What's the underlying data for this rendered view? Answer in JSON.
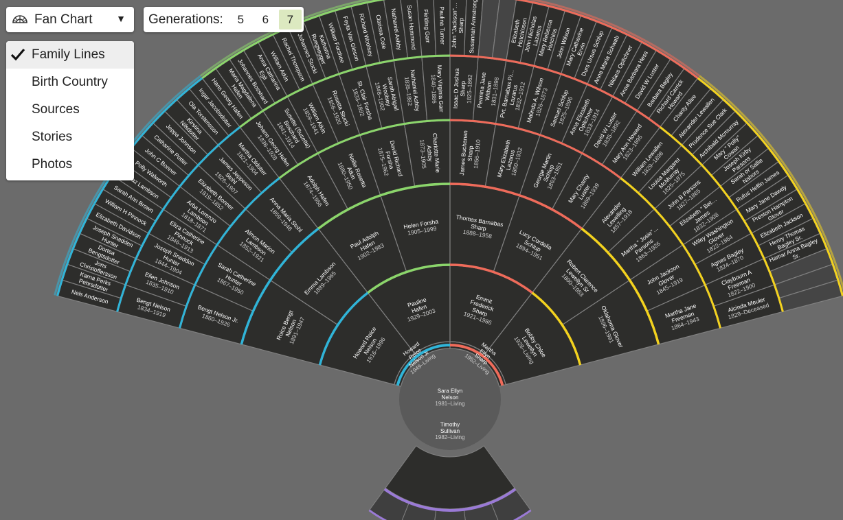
{
  "toolbar": {
    "view_label": "Fan Chart",
    "caret": "▼",
    "fan_icon": "fan-chart-icon",
    "generations_label": "Generations:",
    "generation_options": [
      "5",
      "6",
      "7"
    ],
    "selected_generation": "7"
  },
  "menu": {
    "items": [
      "Family Lines",
      "Birth Country",
      "Sources",
      "Stories",
      "Photos"
    ],
    "checked": "Family Lines",
    "check_icon": "checkmark-icon"
  },
  "colors": {
    "background": "#6b6b6b",
    "cell": "#2d2d2b",
    "divider": "#808080",
    "paternal_paternal": "#8bd56b",
    "paternal_maternal": "#30b4d8",
    "maternal_paternal": "#ef6b5a",
    "maternal_maternal": "#f3d21e",
    "spouse": "#9a7ad6"
  },
  "root": {
    "name": "Sara Ellyn Nelson",
    "dates": "1981–Living"
  },
  "spouse": {
    "name": "Timothy Sullivan",
    "dates": "1982–Living"
  },
  "generations": [
    [
      {
        "name": "Howard Roice Nelson Jr",
        "dates": "1949–Living"
      },
      {
        "name": "Martha Ellyn Sharp",
        "dates": "1952–Living"
      }
    ],
    [
      {
        "name": "Howard Roice Nelson",
        "dates": "1916–1996"
      },
      {
        "name": "Pauline Hafen",
        "dates": "1929–2003"
      },
      {
        "name": "Emmit Frederick Sharp",
        "dates": "1921–1986"
      },
      {
        "name": "Bobby Chloe Lewellyn",
        "dates": "1928–Living"
      }
    ],
    [
      {
        "name": "Roice Bengt Nelson",
        "dates": "1891–1947"
      },
      {
        "name": "Emma Lambson",
        "dates": "1889–1965"
      },
      {
        "name": "Paul Adolph Hafen",
        "dates": "1902–1983"
      },
      {
        "name": "Helen Forsha",
        "dates": "1905–1999"
      },
      {
        "name": "Thomas Barnabas Sharp",
        "dates": "1888–1958"
      },
      {
        "name": "Lucy Cordelia Schlup",
        "dates": "1894–1951"
      },
      {
        "name": "Robert Clarence Lewellyn Sr",
        "dates": "1890–1953"
      },
      {
        "name": "Oklahoma Glover",
        "dates": "1896–1991"
      }
    ],
    [
      {
        "name": "Bengt Nelson Jr.",
        "dates": "1860–1926"
      },
      {
        "name": "Sarah Catherine Hunter",
        "dates": "1867–1950"
      },
      {
        "name": "Almon Marion Lambson",
        "dates": "1852–1921"
      },
      {
        "name": "Anna Maria Stohl",
        "dates": "1859–1948"
      },
      {
        "name": "Adolph Hafen",
        "dates": "1874–1956"
      },
      {
        "name": "Nellie Rosetta Atkin",
        "dates": "1880–1950"
      },
      {
        "name": "David Richard Forsha",
        "dates": "1875–1962"
      },
      {
        "name": "Charlotte Marie Ashby",
        "dates": "1873–1905"
      },
      {
        "name": "James Buchanan Sharp",
        "dates": "1856–1910"
      },
      {
        "name": "Mary Elizabeth Lazarus",
        "dates": "1860–1932"
      },
      {
        "name": "George Martin Schlup",
        "dates": "1863–1951"
      },
      {
        "name": "Mary Charity Luster",
        "dates": "1869–1939"
      },
      {
        "name": "Alexander Lewelling",
        "dates": "1857–1918"
      },
      {
        "name": "Martha \" Josie\"… Parsons",
        "dates": "1863–1926"
      },
      {
        "name": "John Jackson Glover",
        "dates": "1845–1919"
      },
      {
        "name": "Martha Jane Freeman",
        "dates": "1864–1943"
      }
    ],
    [
      {
        "name": "Bengt Nelson",
        "dates": "1834–1919"
      },
      {
        "name": "Ellen Johnson",
        "dates": "1835–1910"
      },
      {
        "name": "Joseph Sneddon Hunter",
        "dates": "1844–1904"
      },
      {
        "name": "Eliza Catherine Pinnock",
        "dates": "1846–1913"
      },
      {
        "name": "Arba Lorenzo Lambson",
        "dates": "1818–1871"
      },
      {
        "name": "Elizabeth Bonner",
        "dates": "1819–1852"
      },
      {
        "name": "James Jeppeson Stohl",
        "dates": "1826–1907"
      },
      {
        "name": "Martha Oldotter",
        "dates": "1821–1904"
      },
      {
        "name": "Johann Georg Hafen",
        "dates": "1838–1928"
      },
      {
        "name": "Susette (Susetta) Bosshard",
        "dates": "1841–1914"
      },
      {
        "name": "William Atkin",
        "dates": "1859–1941"
      },
      {
        "name": "Rosetta Stucki",
        "dates": "1856–1920"
      },
      {
        "name": "St. Clair Forsha",
        "dates": "1833–1892"
      },
      {
        "name": "Sarah Abigail Woolsey",
        "dates": "1848–1902"
      },
      {
        "name": "Nathaniel Ashby",
        "dates": "1835–1882"
      },
      {
        "name": "Mary Virginia Garr",
        "dates": "1840–1886"
      },
      {
        "name": "Isaac D Joshua Sharp",
        "dates": "1825–1862"
      },
      {
        "name": "Permina Jane Witham",
        "dates": "1831–1898"
      },
      {
        "name": "Pvt. Barnabus Pi… Lazarus",
        "dates": "1832–1912"
      },
      {
        "name": "Malinda A. Wilson",
        "dates": "1826–1873"
      },
      {
        "name": "Samuel Schlup",
        "dates": "1825–1896"
      },
      {
        "name": "Anna Elizabeth Opitchner",
        "dates": "1833–1914"
      },
      {
        "name": "David W Luster",
        "dates": "1835–1892"
      },
      {
        "name": "Mary Ann Howard",
        "dates": "1823–1895"
      },
      {
        "name": "William Lewallen",
        "dates": "1829–1898"
      },
      {
        "name": "Louisa Margaret McMurray",
        "dates": "1825–1875"
      },
      {
        "name": "John B Parsons",
        "dates": "1827–1865"
      },
      {
        "name": "Elizabeth \" Bet… James",
        "dates": "1832–1908"
      },
      {
        "name": "Wiley Washington Glover",
        "dates": "1822–1864"
      },
      {
        "name": "Agnes Bagley",
        "dates": "1824–1870"
      },
      {
        "name": "Claybourn A Freeman",
        "dates": "1822–1900"
      },
      {
        "name": "Alcinda Meuler",
        "dates": "1829–Deceased"
      }
    ],
    [
      {
        "name": "Nels Anderson"
      },
      {
        "name": "Karna Perks Pehrsdotter"
      },
      {
        "name": "Jons Christoffersson"
      },
      {
        "name": "Dortea Bengtsdotter"
      },
      {
        "name": "Joseph Snadden Hunter"
      },
      {
        "name": "Elizabeth Davidson"
      },
      {
        "name": "William H Pinnock"
      },
      {
        "name": "Sarah Ann Brown"
      },
      {
        "name": "Boaz Lambson"
      },
      {
        "name": "Polly Walworth"
      },
      {
        "name": "John C Bonner"
      },
      {
        "name": "Catharine Potter"
      },
      {
        "name": "Jeppa Johnson"
      },
      {
        "name": "Kirstina Nilsdotter"
      },
      {
        "name": "Ola Torstensson"
      },
      {
        "name": "Ingar Jacobsdotter"
      },
      {
        "name": "Hans Georg Hafen"
      },
      {
        "name": "Maria Magdalena Hafen"
      },
      {
        "name": "Johannes Bosshard"
      },
      {
        "name": "Anna Catharina Egli"
      },
      {
        "name": "William Atkin"
      },
      {
        "name": "Rachel Thompson"
      },
      {
        "name": "Johannes Stucki"
      },
      {
        "name": "Katharina Ruegsegger"
      },
      {
        "name": "William Forshee"
      },
      {
        "name": "Feyta Van Gieson"
      },
      {
        "name": "Richard Woolsey"
      },
      {
        "name": "Clarissa Cole"
      },
      {
        "name": "Nathaniel Ashby"
      },
      {
        "name": "Susan Hammond"
      },
      {
        "name": "Fielding Garr"
      },
      {
        "name": "Paulina Turner"
      },
      {
        "name": "John \"Jackson\"… Sharp"
      },
      {
        "name": "Susannah Armstrong"
      },
      {
        "name": ""
      },
      {
        "name": ""
      },
      {
        "name": "Elizabeth Hutchinson"
      },
      {
        "name": "John Nicholas Lazarus"
      },
      {
        "name": "Mary Rebecca Hutchins"
      },
      {
        "name": "John Wilson"
      },
      {
        "name": "Mary Catherine Ervin"
      },
      {
        "name": "Durs Ursus Schlup"
      },
      {
        "name": "Anna Maria Schwab"
      },
      {
        "name": "Niklaus Opitchner"
      },
      {
        "name": "Anna Barbara Hess"
      },
      {
        "name": "David W Luster"
      },
      {
        "name": "Barbara Bagley"
      },
      {
        "name": "Richard Carrick Howard"
      },
      {
        "name": "Charity Allee"
      },
      {
        "name": "Alexander Lewallen"
      },
      {
        "name": "Prudence Sue Clark"
      },
      {
        "name": "Archibald Mcmurray"
      },
      {
        "name": "Mary \" Polly\" Cowan"
      },
      {
        "name": "Joseph Kirby Parsons"
      },
      {
        "name": "Sarah or Sallie Nabors"
      },
      {
        "name": "Rufus Heffin James"
      },
      {
        "name": "Mary Jane Dawdy"
      },
      {
        "name": "Preston Hampton Glover"
      },
      {
        "name": "Elizabeth Jackson"
      },
      {
        "name": "Henry Thomas Bagley Sr."
      },
      {
        "name": "Hamar Anna Bagley Sr."
      },
      {
        "name": ""
      },
      {
        "name": ""
      },
      {
        "name": ""
      }
    ]
  ]
}
